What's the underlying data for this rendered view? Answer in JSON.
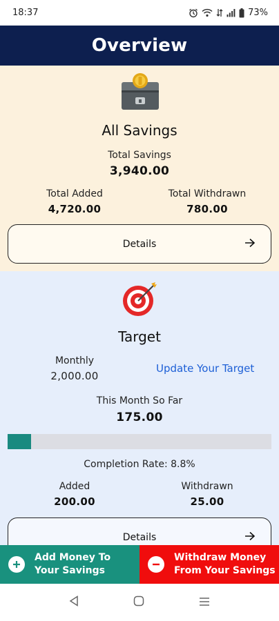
{
  "status_bar": {
    "time": "18:37",
    "battery": "73%",
    "icons": [
      "alarm-icon",
      "wifi-icon",
      "data-icon",
      "signal-icon",
      "battery-icon"
    ]
  },
  "header": {
    "title": "Overview"
  },
  "savings": {
    "icon": "chest-coin-icon",
    "title": "All Savings",
    "total_label": "Total Savings",
    "total_value": "3,940.00",
    "added_label": "Total Added",
    "added_value": "4,720.00",
    "withdrawn_label": "Total Withdrawn",
    "withdrawn_value": "780.00",
    "details_label": "Details"
  },
  "target": {
    "icon": "target-dart-icon",
    "title": "Target",
    "monthly_label": "Monthly",
    "monthly_value": "2,000.00",
    "update_link": "Update Your Target",
    "month_label": "This Month So Far",
    "month_value": "175.00",
    "progress_fraction": 0.088,
    "completion_text": "Completion Rate: 8.8%",
    "added_label": "Added",
    "added_value": "200.00",
    "withdrawn_label": "Withdrawn",
    "withdrawn_value": "25.00",
    "details_label": "Details"
  },
  "actions": {
    "add_label_line1": "Add Money To",
    "add_label_line2": "Your Savings",
    "withdraw_label_line1": "Withdraw Money",
    "withdraw_label_line2": "From Your Savings"
  },
  "colors": {
    "header": "#0d1f4f",
    "savings_bg": "#fcf1dd",
    "target_bg": "#e6eefb",
    "progress": "#1a8a80",
    "add_button": "#19917e",
    "withdraw_button": "#f00d0d",
    "link": "#1d5fd6"
  }
}
